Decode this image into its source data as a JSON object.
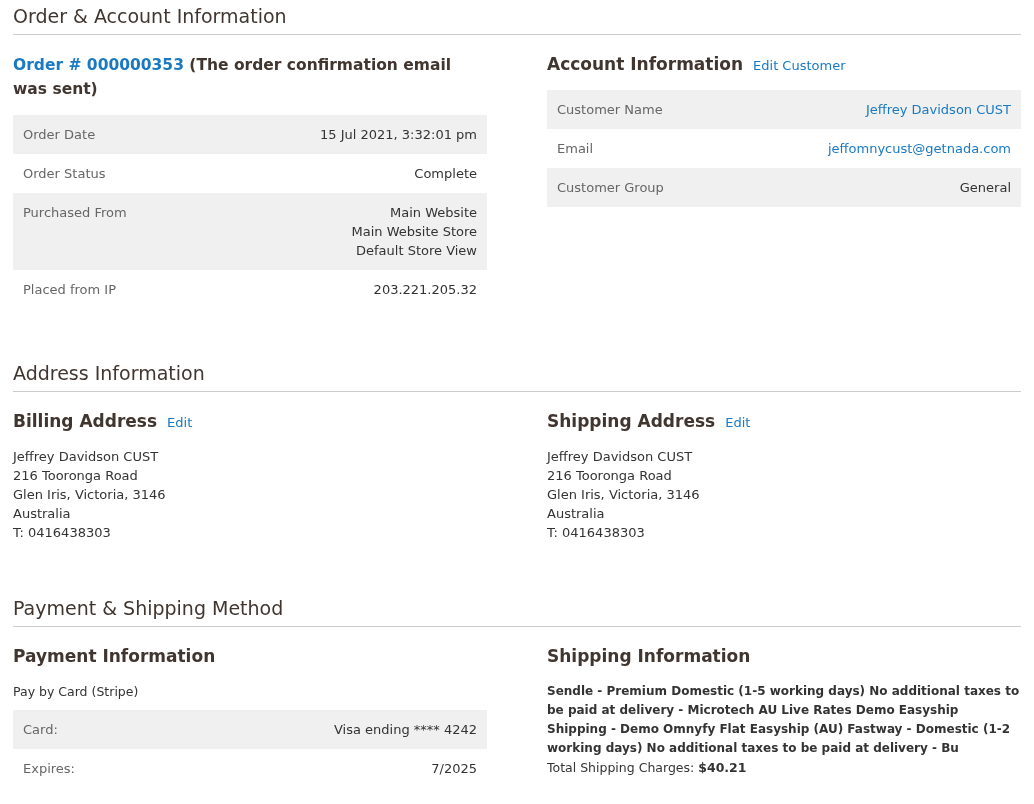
{
  "sections": [
    {
      "title": "Order & Account Information",
      "kind": "order_account",
      "order": {
        "link": "Order # 000000353",
        "note": " (The order confirmation email was sent)",
        "rows": [
          {
            "label": "Order Date",
            "value": [
              "15 Jul 2021, 3:32:01 pm"
            ],
            "link": false
          },
          {
            "label": "Order Status",
            "value": [
              "Complete"
            ],
            "link": false
          },
          {
            "label": "Purchased From",
            "value": [
              "Main Website",
              "Main Website Store",
              "Default Store View"
            ],
            "link": false
          },
          {
            "label": "Placed from IP",
            "value": [
              "203.221.205.32"
            ],
            "link": false
          }
        ]
      },
      "account": {
        "title": "Account Information",
        "action": "Edit Customer",
        "rows": [
          {
            "label": "Customer Name",
            "value": [
              "Jeffrey Davidson CUST"
            ],
            "link": true
          },
          {
            "label": "Email",
            "value": [
              "jeffomnycust@getnada.com"
            ],
            "link": true
          },
          {
            "label": "Customer Group",
            "value": [
              "General"
            ],
            "link": false
          }
        ]
      }
    },
    {
      "title": "Address Information",
      "kind": "addresses",
      "columns": [
        {
          "title": "Billing Address",
          "action": "Edit",
          "lines": [
            "Jeffrey Davidson CUST",
            "216 Tooronga Road",
            "Glen Iris, Victoria, 3146",
            "Australia",
            "T: 0416438303"
          ]
        },
        {
          "title": "Shipping Address",
          "action": "Edit",
          "lines": [
            "Jeffrey Davidson CUST",
            "216 Tooronga Road",
            "Glen Iris, Victoria, 3146",
            "Australia",
            "T: 0416438303"
          ]
        }
      ]
    },
    {
      "title": "Payment & Shipping Method",
      "kind": "payment_shipping",
      "payment": {
        "title": "Payment Information",
        "method": "Pay by Card (Stripe)",
        "rows": [
          {
            "label": "Card:",
            "value": [
              "Visa ending **** 4242"
            ],
            "link": false
          },
          {
            "label": "Expires:",
            "value": [
              "7/2025"
            ],
            "link": false
          }
        ]
      },
      "shipping": {
        "title": "Shipping Information",
        "description": "Sendle - Premium Domestic (1-5 working days) No additional taxes to be paid at delivery - Microtech AU Live Rates Demo Easyship Shipping - Demo Omnyfy Flat Easyship (AU) Fastway - Domestic (1-2 working days) No additional taxes to be paid at delivery - Bu",
        "total": "Total Shipping Charges: **$40.21**"
      }
    }
  ]
}
